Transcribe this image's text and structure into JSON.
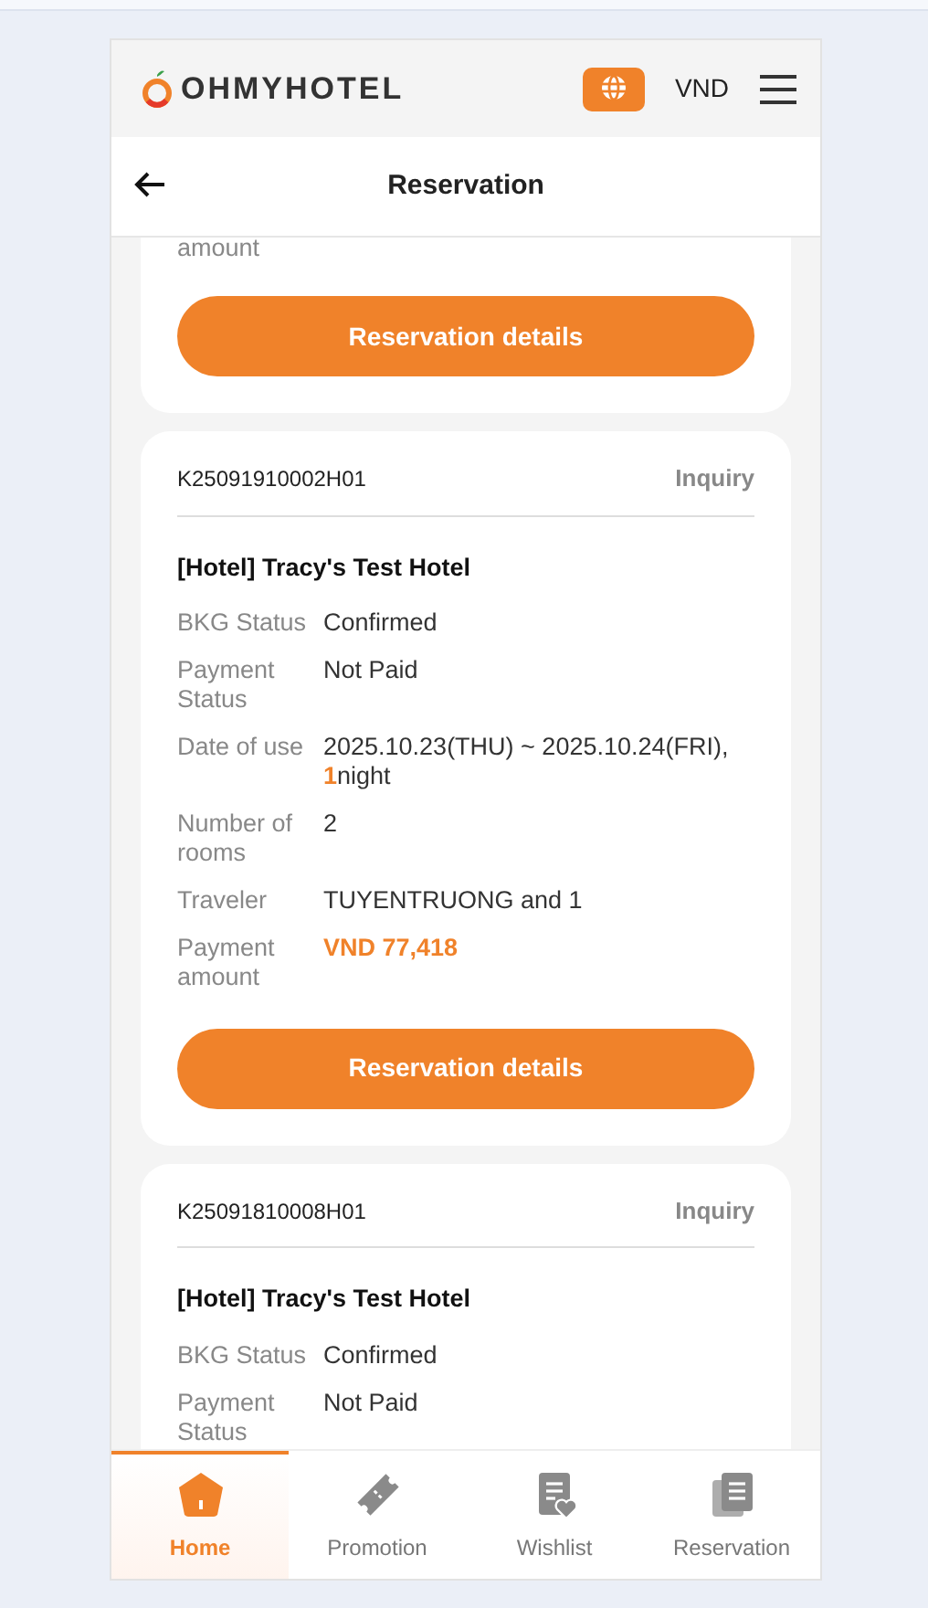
{
  "header": {
    "logo": "OHMYHOTEL",
    "currency": "VND"
  },
  "page_title": "Reservation",
  "reservations": [
    {
      "cut_top": true,
      "rows": [
        {
          "label": "amount",
          "value_parts": []
        }
      ],
      "button": "Reservation details"
    },
    {
      "cut_top": false,
      "code": "K25091910002H01",
      "action": "Inquiry",
      "hotel": "[Hotel] Tracy's Test Hotel",
      "rows": [
        {
          "label": "BKG Status",
          "value_parts": [
            {
              "text": "Confirmed",
              "accent": false
            }
          ]
        },
        {
          "label": "Payment Status",
          "value_parts": [
            {
              "text": "Not Paid",
              "accent": false
            }
          ]
        },
        {
          "label": "Date of use",
          "value_parts": [
            {
              "text": "2025.10.23(THU) ~ 2025.10.24(FRI), ",
              "accent": false
            },
            {
              "text": "1",
              "accent": true
            },
            {
              "text": "night",
              "accent": false
            }
          ]
        },
        {
          "label": "Number of rooms",
          "value_parts": [
            {
              "text": "2",
              "accent": false
            }
          ]
        },
        {
          "label": "Traveler",
          "value_parts": [
            {
              "text": "TUYENTRUONG and 1",
              "accent": false
            }
          ]
        },
        {
          "label": "Payment amount",
          "value_parts": [
            {
              "text": "VND 77,418",
              "accent": true
            }
          ]
        }
      ],
      "button": "Reservation details"
    },
    {
      "cut_top": false,
      "code": "K25091810008H01",
      "action": "Inquiry",
      "hotel": "[Hotel] Tracy's Test Hotel",
      "rows": [
        {
          "label": "BKG Status",
          "value_parts": [
            {
              "text": "Confirmed",
              "accent": false
            }
          ]
        },
        {
          "label": "Payment Status",
          "value_parts": [
            {
              "text": "Not Paid",
              "accent": false
            }
          ]
        }
      ]
    }
  ],
  "bottom_nav": [
    {
      "kind": "home",
      "label": "Home",
      "selected": true
    },
    {
      "kind": "promotion",
      "label": "Promotion",
      "selected": false
    },
    {
      "kind": "wishlist",
      "label": "Wishlist",
      "selected": false
    },
    {
      "kind": "reservation",
      "label": "Reservation",
      "selected": false
    }
  ]
}
